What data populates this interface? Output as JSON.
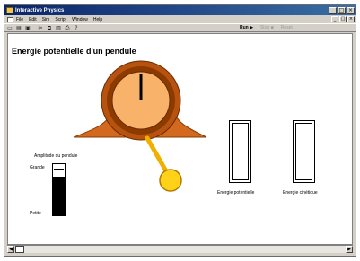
{
  "window": {
    "title": "Interactive Physics",
    "controls": [
      "_",
      "□",
      "×"
    ],
    "doc_controls": [
      "_",
      "□",
      "×"
    ]
  },
  "menu": {
    "items": [
      "File",
      "Edit",
      "Sim",
      "Script",
      "Window",
      "Help"
    ]
  },
  "toolbar": {
    "tools": [
      "new-icon",
      "open-icon",
      "save-icon",
      "cut-icon",
      "copy-icon",
      "paste-icon",
      "print-icon",
      "help-icon"
    ],
    "run_label": "Run ▶",
    "stop_label": "Stop ■",
    "reset_label": "Reset"
  },
  "scene": {
    "title": "Energie potentielle d'un pendule",
    "amplitude_label": "Amplitude du pendule",
    "amplitude_high": "Grande",
    "amplitude_low": "Petite",
    "amplitude_level": 0.75,
    "energy_potential_label": "Energie potentielle",
    "energy_kinetic_label": "Energie cinétique",
    "energy_potential_level": 0,
    "energy_kinetic_level": 0
  },
  "colors": {
    "clock_body": "#d2691e",
    "clock_rim": "#8b3a00",
    "clock_face": "#f9b26a",
    "pendulum_rod": "#f0b000",
    "pendulum_bob": "#ffd21a",
    "titlebar": "#0a246a"
  }
}
